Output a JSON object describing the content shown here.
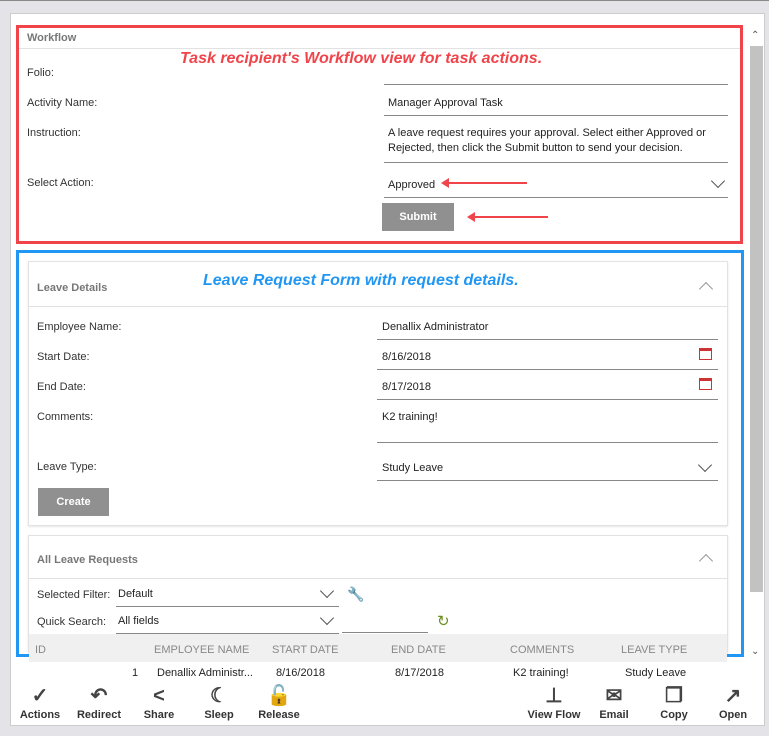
{
  "workflow": {
    "title": "Workflow",
    "note": "Task recipient's Workflow view for task actions.",
    "folio_label": "Folio:",
    "folio_value": "",
    "activity_label": "Activity Name:",
    "activity_value": "Manager Approval Task",
    "instruction_label": "Instruction:",
    "instruction_value": "A leave request requires your approval. Select either Approved or Rejected, then click the Submit button to send your decision.",
    "action_label": "Select Action:",
    "action_value": "Approved",
    "submit": "Submit"
  },
  "leave": {
    "title": "Leave Details",
    "note": "Leave Request Form with request details.",
    "employee_label": "Employee Name:",
    "employee_value": "Denallix Administrator",
    "start_label": "Start Date:",
    "start_value": "8/16/2018",
    "end_label": "End Date:",
    "end_value": "8/17/2018",
    "comments_label": "Comments:",
    "comments_value": "K2 training!",
    "type_label": "Leave Type:",
    "type_value": "Study Leave",
    "create": "Create"
  },
  "requests": {
    "title": "All Leave Requests",
    "filter_label": "Selected Filter:",
    "filter_value": "Default",
    "search_label": "Quick Search:",
    "search_field": "All fields",
    "search_value": "",
    "columns": [
      "ID",
      "EMPLOYEE NAME",
      "START DATE",
      "END DATE",
      "COMMENTS",
      "LEAVE TYPE"
    ],
    "rows": [
      [
        "1",
        "Denallix Administr...",
        "8/16/2018",
        "8/17/2018",
        "K2 training!",
        "Study Leave"
      ]
    ]
  },
  "toolbar": {
    "left": [
      {
        "label": "Actions",
        "icon": "check-x-icon"
      },
      {
        "label": "Redirect",
        "icon": "redirect-icon"
      },
      {
        "label": "Share",
        "icon": "share-icon"
      },
      {
        "label": "Sleep",
        "icon": "moon-icon"
      },
      {
        "label": "Release",
        "icon": "unlock-icon"
      }
    ],
    "right": [
      {
        "label": "View Flow",
        "icon": "flow-icon"
      },
      {
        "label": "Email",
        "icon": "email-icon"
      },
      {
        "label": "Copy",
        "icon": "copy-icon"
      },
      {
        "label": "Open",
        "icon": "open-icon"
      }
    ]
  },
  "colors": {
    "workflow_border": "#f0444a",
    "leave_border": "#2196f3",
    "button": "#909090"
  }
}
